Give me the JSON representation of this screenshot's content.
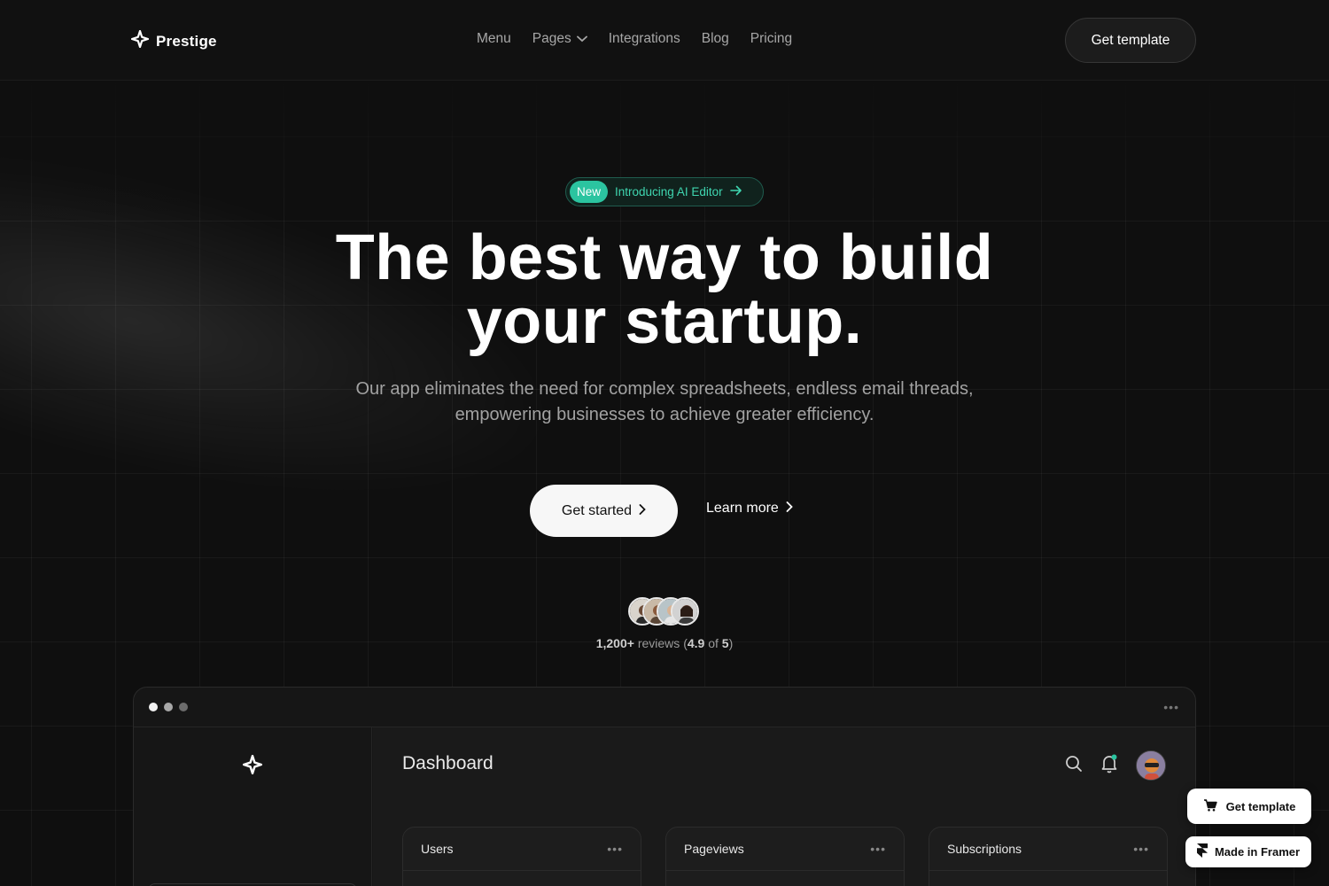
{
  "brand": {
    "name": "Prestige",
    "icon": "sparkle-star-icon"
  },
  "nav": {
    "items": [
      {
        "label": "Menu"
      },
      {
        "label": "Pages",
        "has_dropdown": true
      },
      {
        "label": "Integrations"
      },
      {
        "label": "Blog"
      },
      {
        "label": "Pricing"
      }
    ],
    "cta_label": "Get template"
  },
  "hero": {
    "badge_tag": "New",
    "badge_text": "Introducing AI Editor",
    "title_line1": "The best way to build",
    "title_line2": "your startup.",
    "subtitle_line1": "Our app eliminates the need for complex spreadsheets, endless email threads,",
    "subtitle_line2": "empowering businesses to achieve greater efficiency.",
    "primary_button": "Get started",
    "secondary_button": "Learn more"
  },
  "reviews": {
    "count": "1,200+",
    "text": "reviews",
    "rating_open": "(",
    "rating": "4.9",
    "of_text": "of",
    "max": "5",
    "rating_close": ")"
  },
  "dashboard": {
    "title": "Dashboard",
    "cards": [
      {
        "title": "Users"
      },
      {
        "title": "Pageviews"
      },
      {
        "title": "Subscriptions"
      }
    ],
    "more_glyph": "•••"
  },
  "floating": {
    "get_template": "Get template",
    "made_in_framer": "Made in Framer"
  },
  "colors": {
    "background": "#0f0f0f",
    "accent_teal": "#2bc4a0",
    "notification_dot": "#2bc4a0"
  }
}
